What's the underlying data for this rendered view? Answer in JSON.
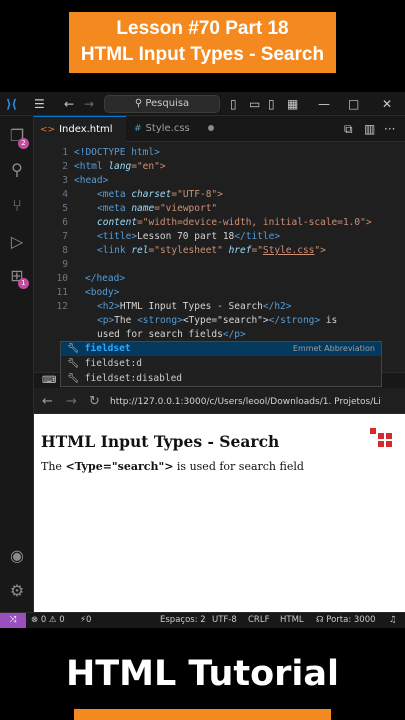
{
  "banner": {
    "line1": "Lesson #70 Part 18",
    "line2": "HTML Input Types - Search"
  },
  "titlebar": {
    "search_label": "Pesquisa",
    "icons": [
      "vscode-logo-icon",
      "menu-icon",
      "back-icon",
      "forward-icon",
      "layout-icons",
      "minimize-icon",
      "maximize-icon",
      "close-icon"
    ]
  },
  "activity": {
    "badges": {
      "explorer": "2",
      "extensions": "1"
    }
  },
  "tabs": [
    {
      "lang": "<>",
      "label": "Index.html"
    },
    {
      "lang": "#",
      "label": "Style.css"
    }
  ],
  "editor": {
    "line_numbers": [
      "1",
      "2",
      "3",
      "4",
      "5",
      "6",
      "7",
      "8",
      "9",
      "10",
      "11",
      "12",
      "",
      "1"
    ],
    "lines": [
      [
        "<!DOCTYPE html>"
      ],
      [
        "<html ",
        "lang",
        "=\"en\">"
      ],
      [
        "<head>"
      ],
      [
        "<meta ",
        "charset",
        "=\"UTF-8\">"
      ],
      [
        "<meta ",
        "name",
        "=\"viewport\""
      ],
      [
        "content",
        "=\"width=device-width, initial-scale=1.0\">"
      ],
      [
        "<title>",
        "Lesson 70 part 18",
        "</title>"
      ],
      [
        "<link ",
        "rel",
        "=\"stylesheet\" ",
        "href",
        "=\"",
        "Style.css",
        "\">"
      ],
      [
        ""
      ],
      [
        "</head>"
      ],
      [
        "<body>"
      ],
      [
        "<h2>",
        "HTML Input Types - Search",
        "</h2>"
      ],
      [
        "<p>",
        "The ",
        "<strong>",
        "&lt;Type=\"search\"&gt;",
        "</strong>",
        " is"
      ],
      [
        "used for search fields",
        "</p>"
      ]
    ]
  },
  "suggest": {
    "items": [
      "fieldset",
      "fieldset:d",
      "fieldset:disabled"
    ],
    "detail": "Emmet Abbreviation"
  },
  "browser": {
    "url": "http://127.0.0.1:3000/c/Users/leool/Downloads/1. Projetos/Li",
    "heading": "HTML Input Types - Search",
    "para_pre": "The ",
    "para_strong": "<Type=\"search\">",
    "para_post": " is used for search field"
  },
  "status": {
    "errors": "⊗ 0 ⚠ 0",
    "ports": "⚡0",
    "spaces": "Espaços: 2",
    "encoding": "UTF-8",
    "eol": "CRLF",
    "language": "HTML",
    "port": "Porta: 3000"
  },
  "footer": {
    "title": "HTML Tutorial"
  },
  "colors": {
    "accent": "#f48a1f",
    "tag": "#569cd6",
    "attr": "#9cdcfe",
    "string": "#ce9178",
    "remote": "#9a4fc0"
  }
}
